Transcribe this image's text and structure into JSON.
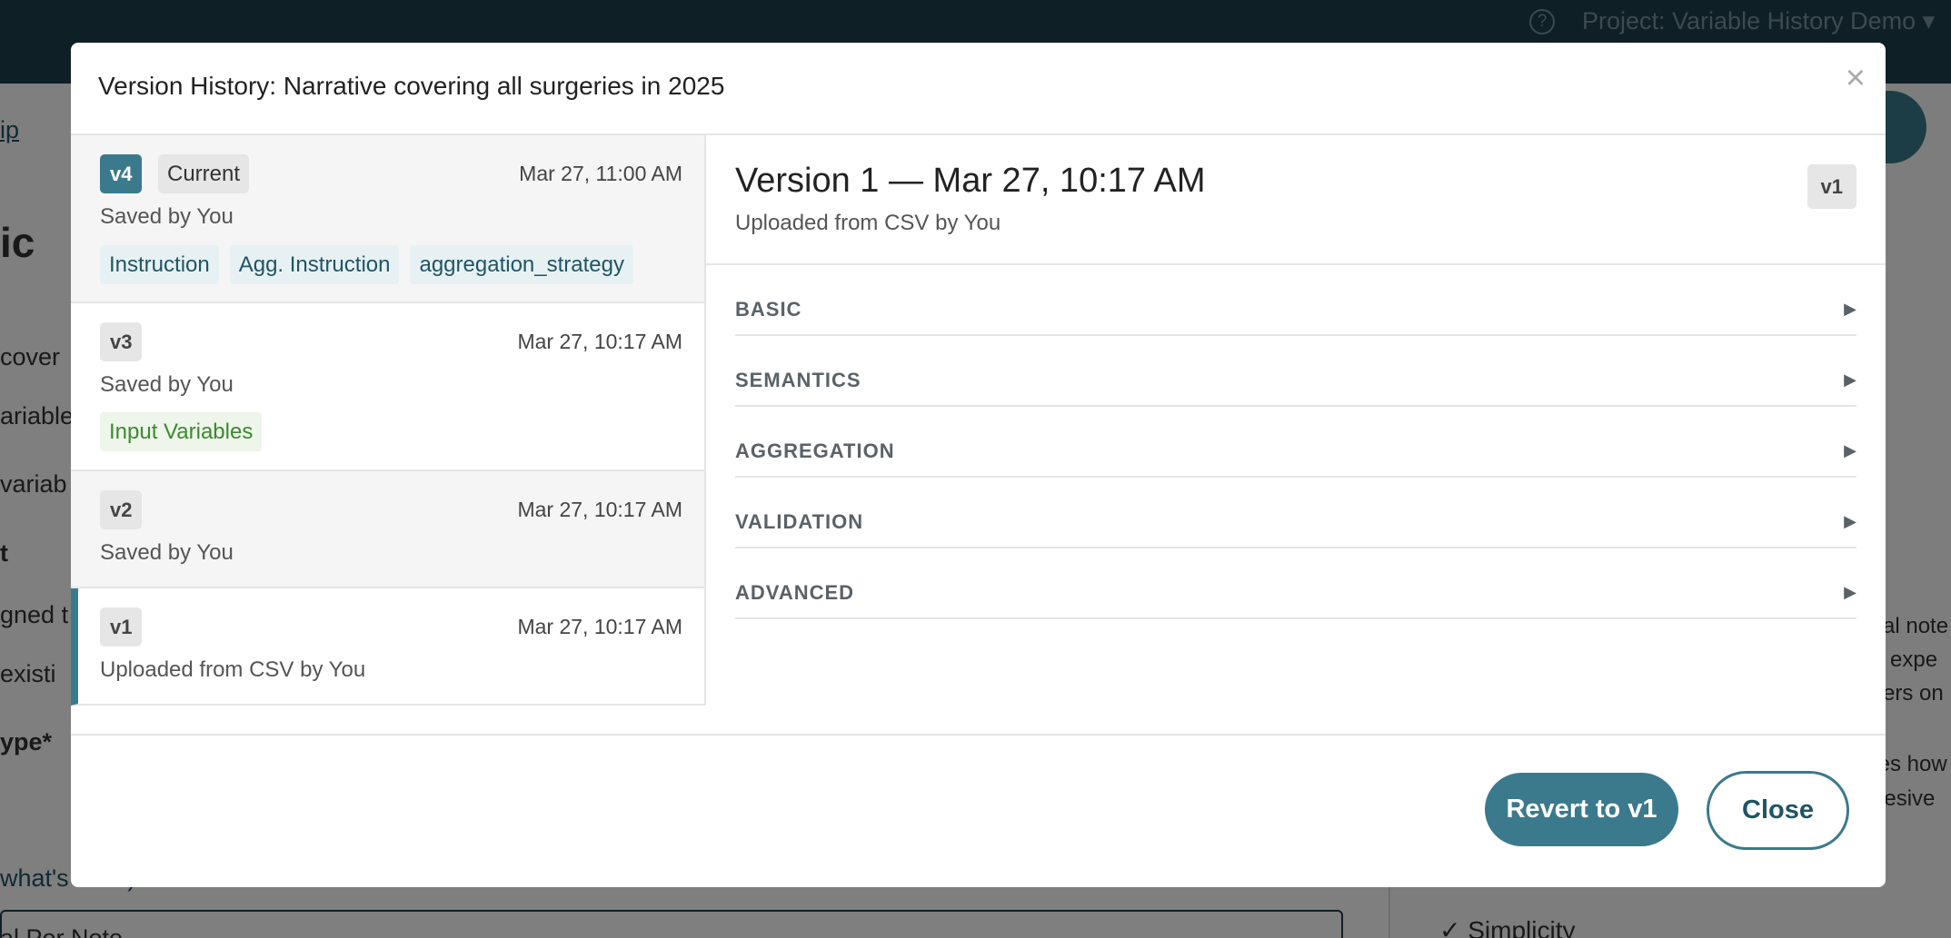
{
  "topbar": {
    "help_icon": "?",
    "project": "Project: Variable History Demo ▾"
  },
  "background": {
    "link": "ip",
    "heading": "ic",
    "line1": "cover",
    "line2": "ariable,",
    "line3": "variab",
    "line4": "t",
    "line5": "gned t",
    "line6": "existi",
    "line7": "ype*",
    "line8": "what's this?)",
    "line9": "al Per Note",
    "right1": "cal note",
    "right2": "e expe",
    "right3": "sers on",
    "right4": "tes how",
    "right5": "hesive",
    "right6": "✓ Simplicity"
  },
  "modal": {
    "title": "Version History: Narrative covering all surgeries in 2025",
    "close_symbol": "×",
    "versions": [
      {
        "badge": "v4",
        "current_label": "Current",
        "date": "Mar 27, 11:00 AM",
        "by": "Saved by You",
        "chips": [
          "Instruction",
          "Agg. Instruction",
          "aggregation_strategy"
        ]
      },
      {
        "badge": "v3",
        "date": "Mar 27, 10:17 AM",
        "by": "Saved by You",
        "chips": [
          "Input Variables"
        ]
      },
      {
        "badge": "v2",
        "date": "Mar 27, 10:17 AM",
        "by": "Saved by You"
      },
      {
        "badge": "v1",
        "date": "Mar 27, 10:17 AM",
        "by": "Uploaded from CSV by You"
      }
    ],
    "detail": {
      "title": "Version 1 — Mar 27, 10:17 AM",
      "subtitle": "Uploaded from CSV by You",
      "badge": "v1",
      "sections": [
        "BASIC",
        "SEMANTICS",
        "AGGREGATION",
        "VALIDATION",
        "ADVANCED"
      ],
      "arrow": "▶"
    },
    "footer": {
      "revert_label": "Revert to v1",
      "close_label": "Close"
    }
  }
}
